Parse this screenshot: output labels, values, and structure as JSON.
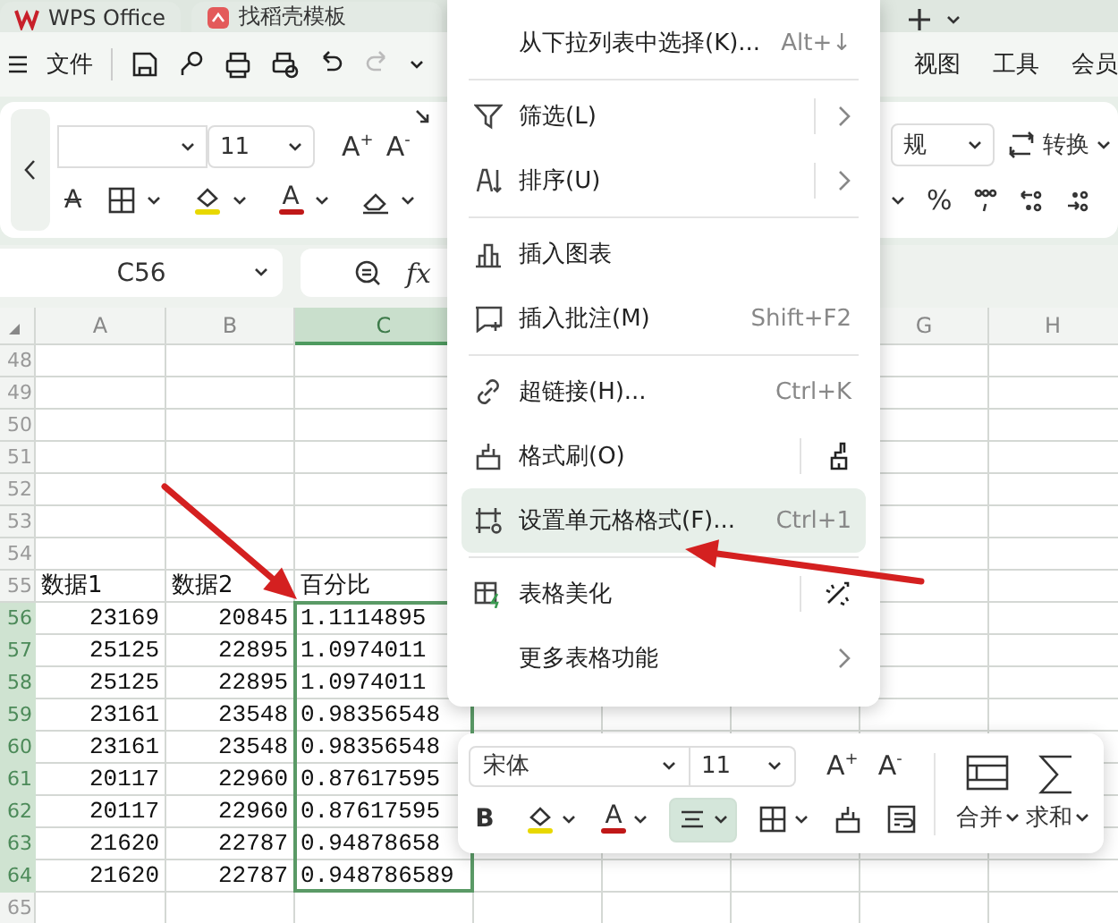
{
  "tabs": [
    {
      "label": "WPS Office"
    },
    {
      "label": "找稻壳模板"
    }
  ],
  "menu_bar": {
    "file_label": "文件",
    "tabs": [
      {
        "label": "视图"
      },
      {
        "label": "工具"
      },
      {
        "label": "会员"
      }
    ]
  },
  "ribbon": {
    "font_size": "11",
    "grow_label": "A$^{+}$",
    "shrink_label": "A$^{-}$",
    "strike_label": "A",
    "font_color_label": "A",
    "number_format": "规",
    "convert_label": "转换",
    "percent_label": "%"
  },
  "formula_bar": {
    "cell_ref": "C56",
    "fx_label": "fx"
  },
  "sheet": {
    "columns": [
      {
        "label": "A",
        "selected": false
      },
      {
        "label": "B",
        "selected": false
      },
      {
        "label": "C",
        "selected": true
      },
      {
        "label": "G",
        "selected": false
      },
      {
        "label": "H",
        "selected": false
      }
    ],
    "rows": [
      {
        "number": "48",
        "selected": false
      },
      {
        "number": "49",
        "selected": false
      },
      {
        "number": "50",
        "selected": false
      },
      {
        "number": "51",
        "selected": false
      },
      {
        "number": "52",
        "selected": false
      },
      {
        "number": "53",
        "selected": false
      },
      {
        "number": "54",
        "selected": false
      },
      {
        "number": "55",
        "selected": false,
        "cells": [
          "数据1",
          "数据2",
          "百分比"
        ]
      },
      {
        "number": "56",
        "selected": true,
        "cells": [
          "23169",
          "20845",
          "1.1114895"
        ]
      },
      {
        "number": "57",
        "selected": true,
        "cells": [
          "25125",
          "22895",
          "1.0974011"
        ]
      },
      {
        "number": "58",
        "selected": true,
        "cells": [
          "25125",
          "22895",
          "1.0974011"
        ]
      },
      {
        "number": "59",
        "selected": true,
        "cells": [
          "23161",
          "23548",
          "0.98356548"
        ]
      },
      {
        "number": "60",
        "selected": true,
        "cells": [
          "23161",
          "23548",
          "0.98356548"
        ]
      },
      {
        "number": "61",
        "selected": true,
        "cells": [
          "20117",
          "22960",
          "0.87617595"
        ]
      },
      {
        "number": "62",
        "selected": true,
        "cells": [
          "20117",
          "22960",
          "0.87617595"
        ]
      },
      {
        "number": "63",
        "selected": true,
        "cells": [
          "21620",
          "22787",
          "0.94878658"
        ]
      },
      {
        "number": "64",
        "selected": true,
        "cells": [
          "21620",
          "22787",
          "0.948786589"
        ]
      },
      {
        "number": "65",
        "selected": false
      }
    ]
  },
  "context_menu": {
    "items": [
      {
        "kind": "item",
        "label": "从下拉列表中选择(K)...",
        "shortcut": "Alt+↓",
        "selected": false
      },
      {
        "kind": "divider"
      },
      {
        "kind": "submenu",
        "label": "筛选(L)",
        "selected": false
      },
      {
        "kind": "submenu",
        "label": "排序(U)",
        "selected": false
      },
      {
        "kind": "divider"
      },
      {
        "kind": "item",
        "label": "插入图表",
        "selected": false
      },
      {
        "kind": "item",
        "label": "插入批注(M)",
        "shortcut": "Shift+F2",
        "selected": false
      },
      {
        "kind": "divider"
      },
      {
        "kind": "item",
        "label": "超链接(H)...",
        "shortcut": "Ctrl+K",
        "selected": false
      },
      {
        "kind": "tool",
        "label": "格式刷(O)",
        "selected": false
      },
      {
        "kind": "item",
        "label": "设置单元格格式(F)...",
        "shortcut": "Ctrl+1",
        "selected": true
      },
      {
        "kind": "divider"
      },
      {
        "kind": "tool",
        "label": "表格美化",
        "selected": false
      },
      {
        "kind": "submenu",
        "label": "更多表格功能",
        "selected": false
      }
    ]
  },
  "mini_toolbar": {
    "font": "宋体",
    "size": "11",
    "grow_label": "A$^{+}$",
    "shrink_label": "A$^{-}$",
    "bold_label": "B",
    "font_color_label": "A",
    "align_selected": true,
    "buttons": [
      {
        "label": "合并"
      },
      {
        "label": "求和"
      }
    ]
  }
}
